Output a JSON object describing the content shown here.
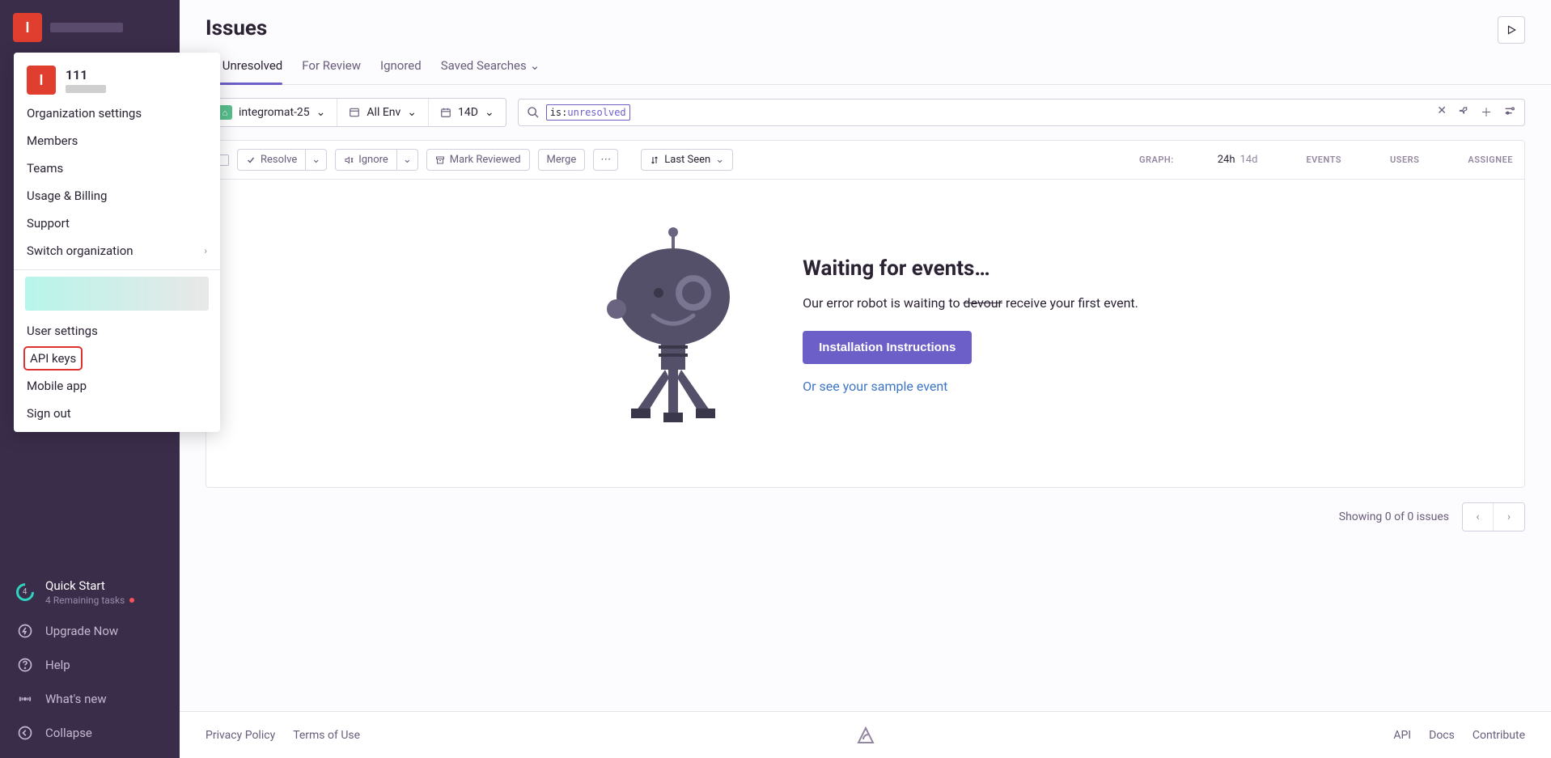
{
  "sidebar": {
    "org_initial": "I",
    "quick_start": {
      "number": "4",
      "label": "Quick Start",
      "sub": "4 Remaining tasks"
    },
    "upgrade": "Upgrade Now",
    "help": "Help",
    "whatsnew": "What's new",
    "collapse": "Collapse"
  },
  "popover": {
    "org_initial": "I",
    "org_name": "111",
    "items_org": [
      "Organization settings",
      "Members",
      "Teams",
      "Usage & Billing",
      "Support",
      "Switch organization"
    ],
    "items_user": [
      "User settings",
      "API keys",
      "Mobile app",
      "Sign out"
    ]
  },
  "header": {
    "title": "Issues"
  },
  "tabs": [
    {
      "label": "All Unresolved",
      "active": true
    },
    {
      "label": "For Review"
    },
    {
      "label": "Ignored"
    },
    {
      "label": "Saved Searches",
      "chevron": true
    }
  ],
  "filters": {
    "project": "integromat-25",
    "env": "All Env",
    "range": "14D",
    "search_key": "is:",
    "search_val": "unresolved"
  },
  "list": {
    "resolve": "Resolve",
    "ignore": "Ignore",
    "mark": "Mark Reviewed",
    "merge": "Merge",
    "seen": "Last Seen",
    "col_graph": "GRAPH:",
    "time_24h": "24h",
    "time_14d": "14d",
    "col_events": "EVENTS",
    "col_users": "USERS",
    "col_assignee": "ASSIGNEE"
  },
  "empty": {
    "heading": "Waiting for events…",
    "text_pre": "Our error robot is waiting to ",
    "text_strike": "devour",
    "text_post": " receive your first event.",
    "button": "Installation Instructions",
    "link": "Or see your sample event"
  },
  "pager": {
    "text": "Showing 0 of 0 issues"
  },
  "footer": {
    "privacy": "Privacy Policy",
    "terms": "Terms of Use",
    "api": "API",
    "docs": "Docs",
    "contribute": "Contribute"
  }
}
